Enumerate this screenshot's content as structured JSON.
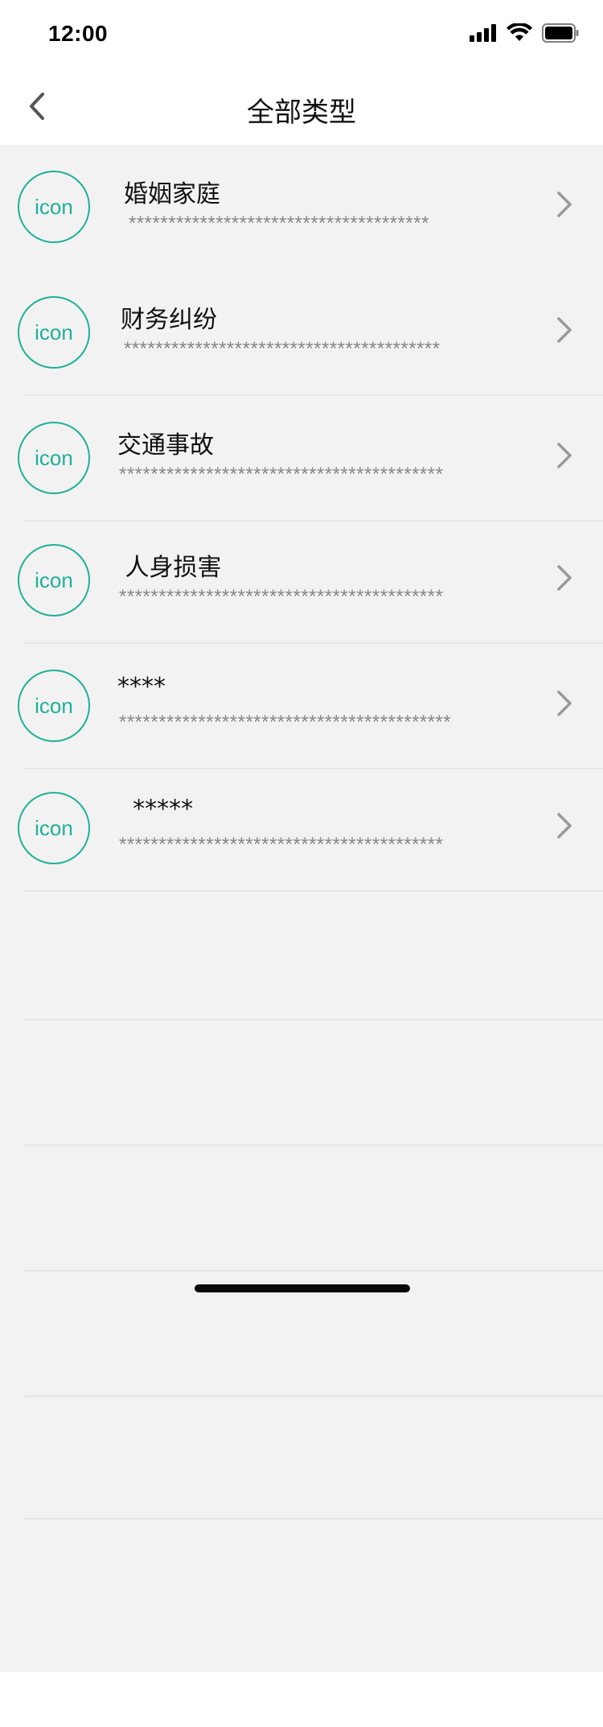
{
  "status_bar": {
    "time": "12:00"
  },
  "nav": {
    "title": "全部类型",
    "back_icon": "chevron-left-icon"
  },
  "items": [
    {
      "title": "婚姻家庭",
      "desc": "**************************************",
      "icon_text": "icon"
    },
    {
      "title": "财务纠纷",
      "desc": "****************************************",
      "icon_text": "icon"
    },
    {
      "title": "交通事故",
      "desc": "*****************************************",
      "icon_text": "icon"
    },
    {
      "title": " 人身损害",
      "desc": "*****************************************",
      "icon_text": "icon"
    },
    {
      "title": "****",
      "desc": "******************************************",
      "icon_text": "icon"
    },
    {
      "title": "  *****",
      "desc": "*****************************************",
      "icon_text": "icon"
    }
  ],
  "colors": {
    "accent": "#1fb197",
    "background": "#f2f2f2",
    "divider": "#e6e6e6"
  }
}
